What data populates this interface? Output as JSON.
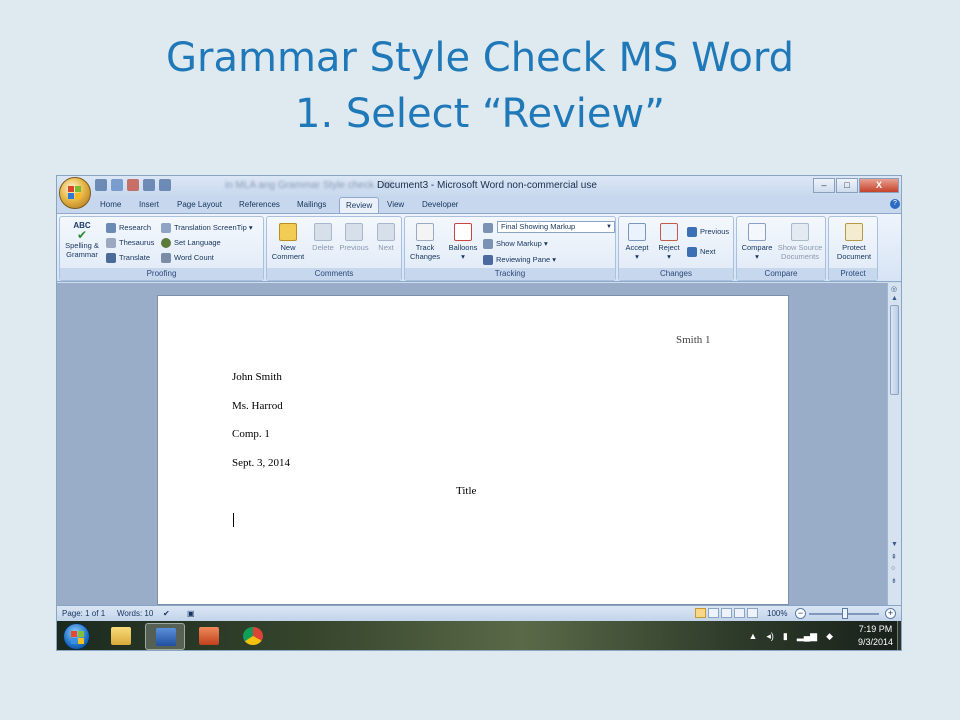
{
  "slide": {
    "title_line1": "Grammar Style Check MS Word",
    "title_line2": "1. Select “Review”"
  },
  "window": {
    "title": "Document3 - Microsoft Word non-commercial use",
    "background_doc_title": "in MLA ang Grammar Style check - Mi",
    "controls": [
      "–",
      "□",
      "X"
    ]
  },
  "tabs": [
    {
      "label": "Home"
    },
    {
      "label": "Insert"
    },
    {
      "label": "Page Layout"
    },
    {
      "label": "References"
    },
    {
      "label": "Mailings"
    },
    {
      "label": "Review",
      "active": true
    },
    {
      "label": "View"
    },
    {
      "label": "Developer"
    }
  ],
  "ribbon": {
    "proofing": {
      "label": "Proofing",
      "spelling_line1": "Spelling &",
      "spelling_line2": "Grammar",
      "abc": "ABC",
      "research": "Research",
      "thesaurus": "Thesaurus",
      "translate": "Translate",
      "translation_screentip": "Translation ScreenTip",
      "set_language": "Set Language",
      "word_count": "Word Count"
    },
    "comments": {
      "label": "Comments",
      "new_line1": "New",
      "new_line2": "Comment",
      "delete": "Delete",
      "previous": "Previous",
      "next": "Next"
    },
    "tracking": {
      "label": "Tracking",
      "track_line1": "Track",
      "track_line2": "Changes",
      "balloons": "Balloons",
      "markup_select": "Final Showing Markup",
      "show_markup": "Show Markup",
      "reviewing_pane": "Reviewing Pane"
    },
    "changes": {
      "label": "Changes",
      "accept": "Accept",
      "reject": "Reject",
      "previous": "Previous",
      "next": "Next"
    },
    "compare": {
      "label": "Compare",
      "compare": "Compare",
      "show_source_line1": "Show Source",
      "show_source_line2": "Documents"
    },
    "protect": {
      "label": "Protect",
      "protect_line1": "Protect",
      "protect_line2": "Document"
    }
  },
  "document": {
    "header": "Smith 1",
    "lines": [
      "John Smith",
      "Ms. Harrod",
      "Comp. 1",
      "Sept. 3, 2014"
    ],
    "title": "Title"
  },
  "status": {
    "page": "Page: 1 of 1",
    "words": "Words: 10",
    "zoom": "100%"
  },
  "taskbar": {
    "time": "7:19 PM",
    "date": "9/3/2014"
  },
  "colors": {
    "slide_title": "#1f78b8",
    "slide_bg": "#dfe9f0",
    "ribbon_blue": "#c7d8ee"
  }
}
